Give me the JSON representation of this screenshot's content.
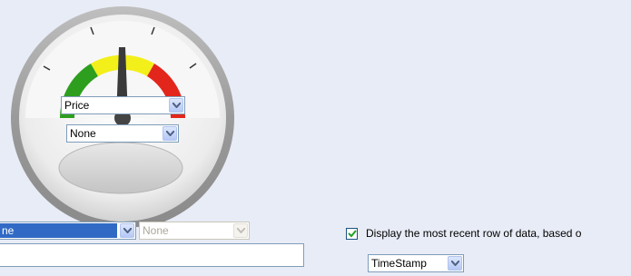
{
  "gauge": {
    "value_field": {
      "selected": "Price"
    },
    "secondary_field": {
      "selected": "None"
    }
  },
  "bottom": {
    "field_combo": {
      "selected": "ne"
    },
    "second_combo": {
      "selected": "None"
    },
    "text_input": {
      "value": ""
    },
    "recent_row": {
      "checked": true,
      "label": "Display the most recent row of data, based o"
    },
    "order_combo": {
      "selected": "TimeStamp"
    }
  },
  "colors": {
    "background": "#e8ecf6",
    "zone_green": "#2e9e1f",
    "zone_yellow": "#f3ef1a",
    "zone_red": "#e3261c",
    "selection": "#316ac5",
    "check": "#21a121"
  }
}
